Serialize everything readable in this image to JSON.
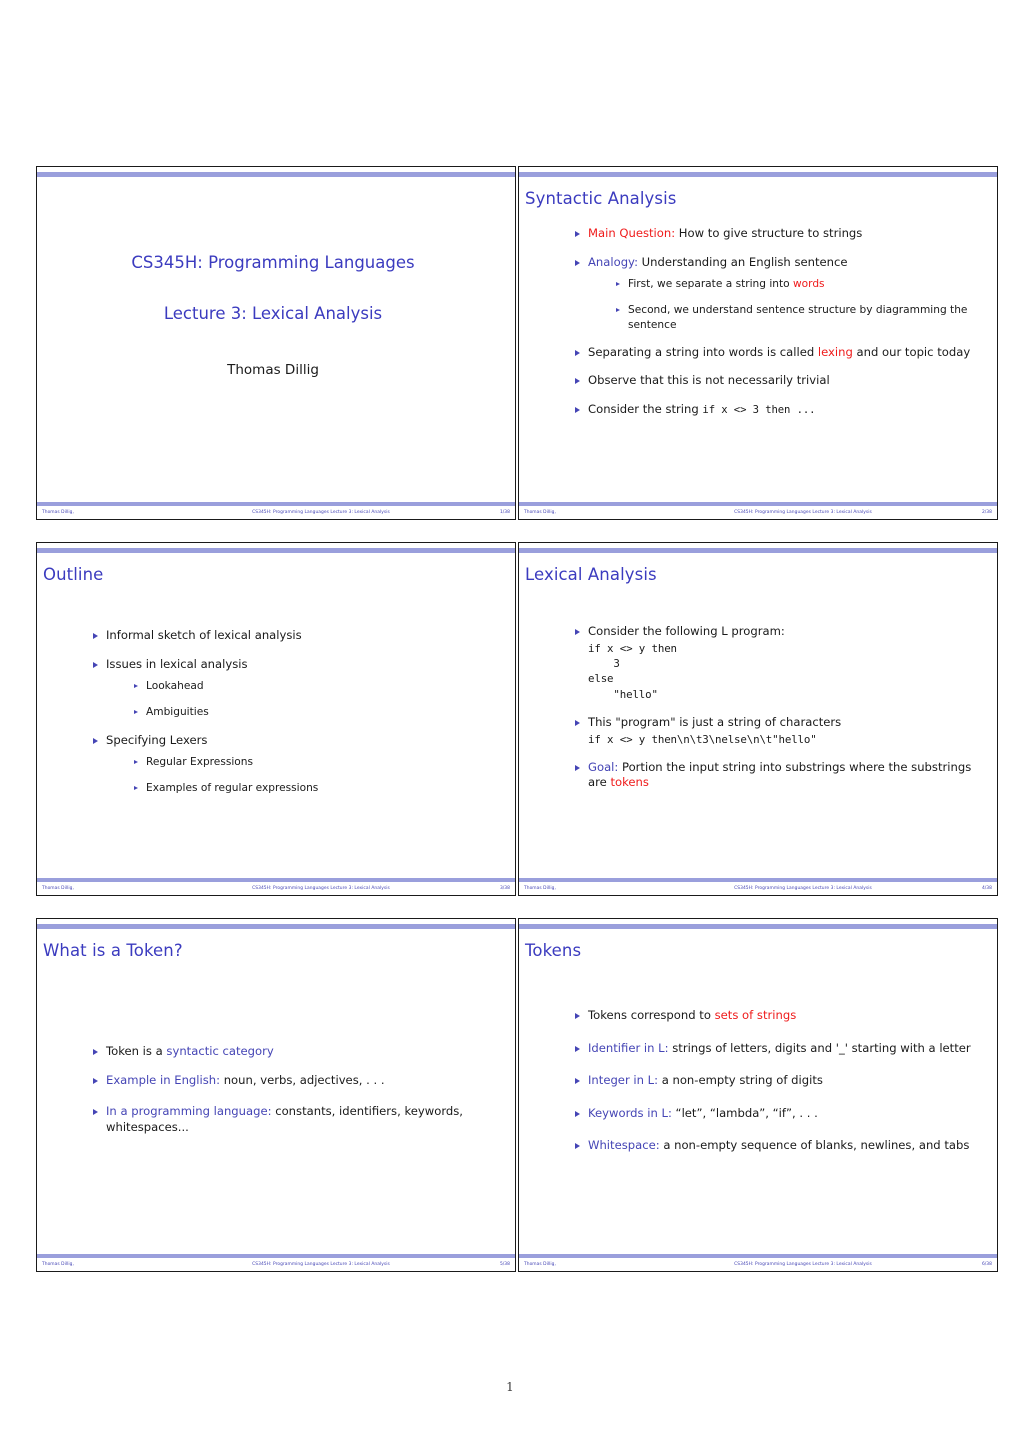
{
  "document": {
    "page_number": "1",
    "accent_blue": "#3b3bbf",
    "accent_red": "#ef1b1b",
    "bar_lavender": "#9a9fdc"
  },
  "footer": {
    "author": "Thomas Dillig,",
    "center": "CS345H: Programming Languages   Lecture 3: Lexical Analysis"
  },
  "slides": [
    {
      "kind": "title",
      "course_title": "CS345H: Programming Languages",
      "lecture_title": "Lecture 3: Lexical Analysis",
      "author": "Thomas Dillig",
      "page": "1/38"
    },
    {
      "kind": "content",
      "title": "Syntactic Analysis",
      "page": "2/38",
      "bullets": [
        {
          "label": "Main Question:",
          "label_color": "red",
          "text": " How to give structure to strings"
        },
        {
          "label": "Analogy:",
          "label_color": "blue",
          "text": " Understanding an English sentence",
          "sub": [
            {
              "pre": "First, we separate a string into ",
              "accent": "words",
              "accent_color": "red",
              "post": ""
            },
            {
              "pre": "Second, we understand sentence structure by diagramming the sentence",
              "accent": "",
              "post": ""
            }
          ]
        },
        {
          "pre": "Separating a string into words is called ",
          "accent": "lexing",
          "accent_color": "red",
          "post": " and our topic today"
        },
        {
          "text": "Observe that this is not necessarily trivial"
        },
        {
          "pre": "Consider the string ",
          "mono": "if x <> 3 then ...",
          "post": ""
        }
      ]
    },
    {
      "kind": "content",
      "title": "Outline",
      "page": "3/38",
      "bullets": [
        {
          "text": "Informal sketch of lexical analysis"
        },
        {
          "text": "Issues in lexical analysis",
          "sub": [
            {
              "pre": "Lookahead"
            },
            {
              "pre": "Ambiguities"
            }
          ]
        },
        {
          "text": "Specifying Lexers",
          "sub": [
            {
              "pre": "Regular Expressions"
            },
            {
              "pre": "Examples of regular expressions"
            }
          ]
        }
      ]
    },
    {
      "kind": "content",
      "title": "Lexical Analysis",
      "page": "4/38",
      "bullets": [
        {
          "text": "Consider the following L program:",
          "code": "if x <> y then\n    3\nelse\n    \"hello\""
        },
        {
          "text": "This \"program\" is just a string of characters",
          "code": "if x <> y then\\n\\t3\\nelse\\n\\t\"hello\""
        },
        {
          "label": "Goal:",
          "label_color": "blue",
          "pre": " Portion the input string into substrings where the substrings are ",
          "accent": "tokens",
          "accent_color": "red",
          "post": ""
        }
      ]
    },
    {
      "kind": "content",
      "title": "What is a Token?",
      "page": "5/38",
      "top_pad": "74px",
      "bullets": [
        {
          "pre": "Token is a ",
          "accent": "syntactic category",
          "accent_color": "blue",
          "post": ""
        },
        {
          "label": "Example in English:",
          "label_color": "blue",
          "text": " noun, verbs, adjectives, . . ."
        },
        {
          "label": "In a programming language:",
          "label_color": "blue",
          "text": " constants, identifiers, keywords, whitespaces..."
        }
      ]
    },
    {
      "kind": "content",
      "title": "Tokens",
      "page": "6/38",
      "top_pad": "38px",
      "bullets": [
        {
          "pre": "Tokens correspond to ",
          "accent": "sets of strings",
          "accent_color": "red",
          "post": ""
        },
        {
          "label": "Identifier in L:",
          "label_color": "blue",
          "text": " strings of letters, digits and '_' starting with a letter"
        },
        {
          "label": "Integer in L:",
          "label_color": "blue",
          "text": " a non-empty string of digits"
        },
        {
          "label": "Keywords in L:",
          "label_color": "blue",
          "text": " “let”, “lambda”, “if”, . . ."
        },
        {
          "label": "Whitespace:",
          "label_color": "blue",
          "text": " a non-empty sequence of blanks, newlines, and tabs"
        }
      ]
    }
  ]
}
